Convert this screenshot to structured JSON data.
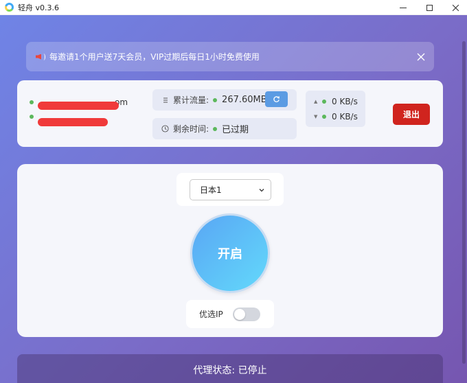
{
  "window": {
    "title": "轻舟 v0.3.6"
  },
  "notice": {
    "text": "每邀请1个用户送7天会员，VIP过期后每日1小时免费使用"
  },
  "account": {
    "email_visible_suffix": "om"
  },
  "traffic": {
    "label": "累计流量:",
    "value": "267.60MB"
  },
  "time_left": {
    "label": "剩余时间:",
    "value": "已过期"
  },
  "speed": {
    "upload": "0 KB/s",
    "download": "0 KB/s"
  },
  "logout_label": "退出",
  "server_select": {
    "selected": "日本1"
  },
  "power_button_label": "开启",
  "preferred_ip": {
    "label": "优选IP",
    "enabled": false
  },
  "status": {
    "text": "代理状态: 已停止"
  },
  "colors": {
    "accent": "#5b9be3",
    "danger": "#d0241e",
    "online_dot": "#5cb85c"
  }
}
